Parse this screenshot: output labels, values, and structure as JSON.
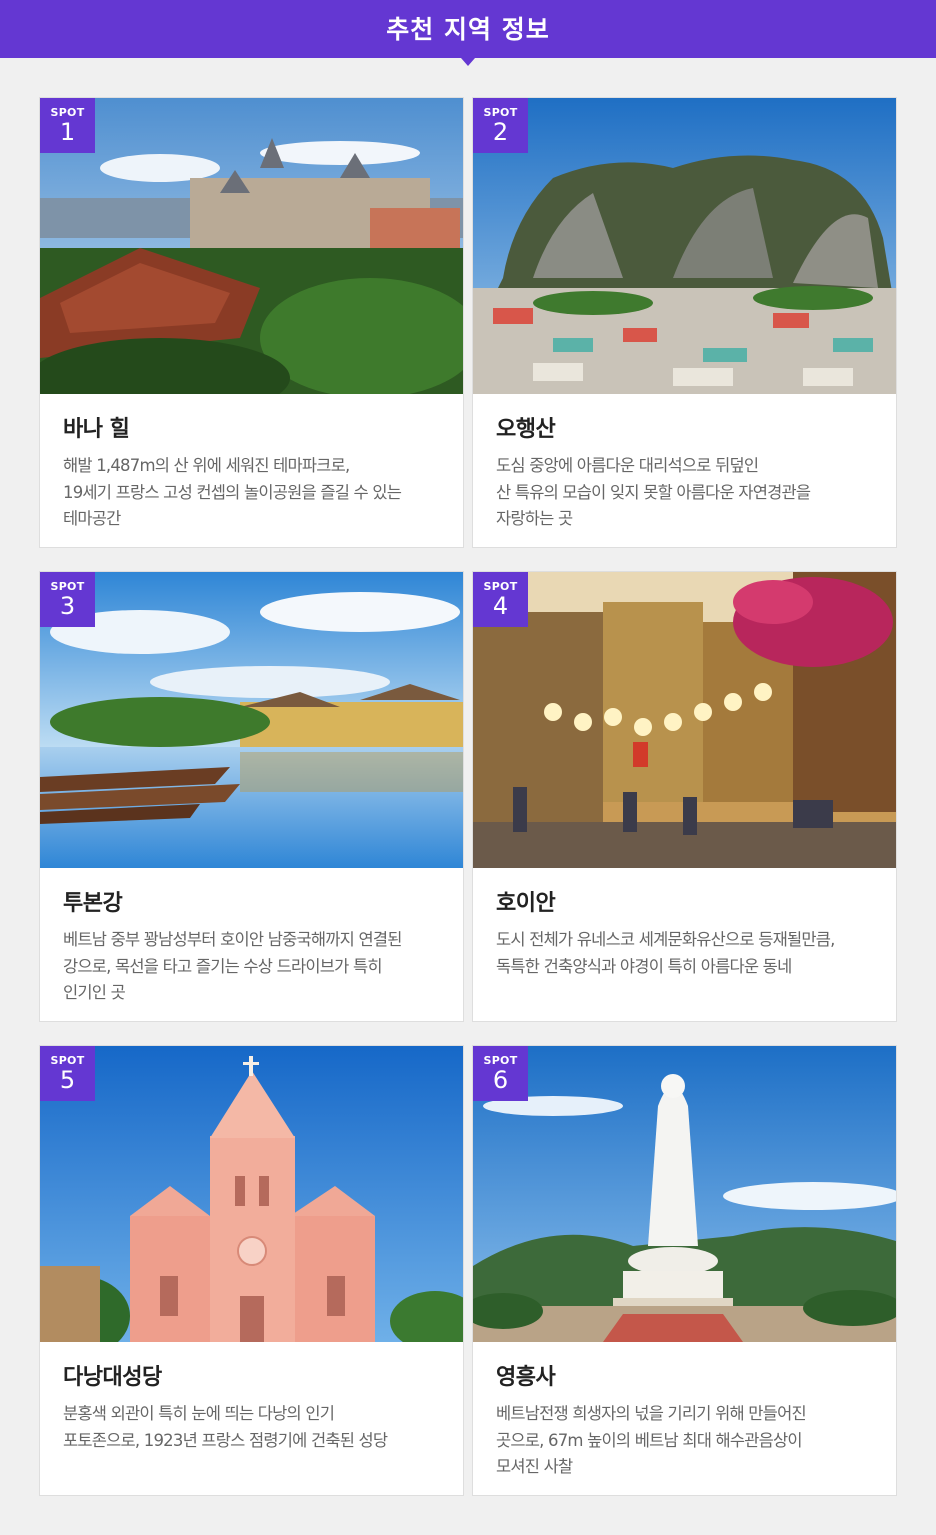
{
  "header": {
    "title": "추천 지역 정보"
  },
  "colors": {
    "accent": "#6437d2",
    "background": "#f0f0f0"
  },
  "spots": [
    {
      "badge": "SPOT",
      "number": "1",
      "name": "바나 힐",
      "description": "해발 1,487m의 산 위에 세워진 테마파크로,\n19세기 프랑스 고성 컨셉의 놀이공원을 즐길 수 있는\n테마공간"
    },
    {
      "badge": "SPOT",
      "number": "2",
      "name": "오행산",
      "description": "도심 중앙에 아름다운 대리석으로 뒤덮인\n산 특유의 모습이 잊지 못할 아름다운 자연경관을\n자랑하는 곳"
    },
    {
      "badge": "SPOT",
      "number": "3",
      "name": "투본강",
      "description": "베트남 중부 꽝남성부터 호이안 남중국해까지 연결된\n강으로, 목선을 타고 즐기는 수상 드라이브가 특히\n인기인 곳"
    },
    {
      "badge": "SPOT",
      "number": "4",
      "name": "호이안",
      "description": "도시 전체가 유네스코 세계문화유산으로 등재될만큼,\n독특한 건축양식과 야경이 특히 아름다운 동네"
    },
    {
      "badge": "SPOT",
      "number": "5",
      "name": "다낭대성당",
      "description": "분홍색 외관이 특히 눈에 띄는 다낭의 인기\n포토존으로, 1923년 프랑스 점령기에 건축된 성당"
    },
    {
      "badge": "SPOT",
      "number": "6",
      "name": "영흥사",
      "description": "베트남전쟁 희생자의 넋을 기리기 위해 만들어진\n곳으로, 67m 높이의 베트남 최대 해수관음상이\n모셔진 사찰"
    }
  ]
}
